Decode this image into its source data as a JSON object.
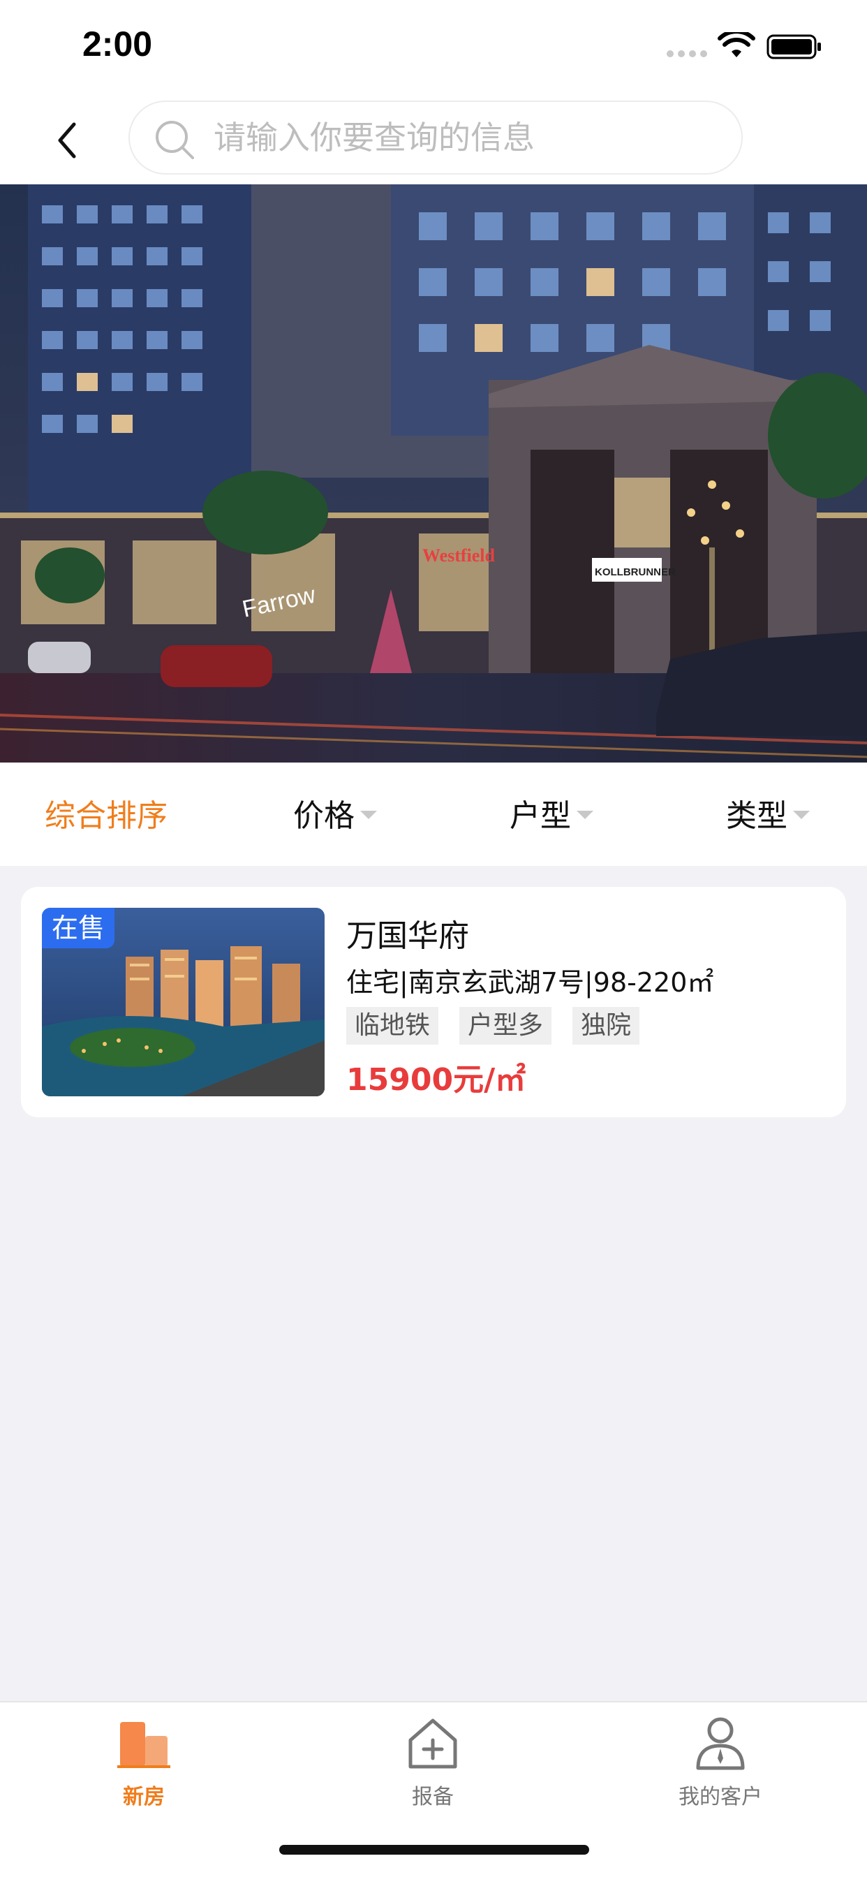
{
  "status_bar": {
    "time": "2:00"
  },
  "search": {
    "placeholder": "请输入你要查询的信息",
    "value": ""
  },
  "banner": {
    "signs": [
      "Farrow",
      "Westfield",
      "KOLLBRUNNER"
    ],
    "page_count": 2,
    "active_page": 2
  },
  "filters": [
    {
      "label": "综合排序",
      "active": true
    },
    {
      "label": "价格",
      "active": false
    },
    {
      "label": "户型",
      "active": false
    },
    {
      "label": "类型",
      "active": false
    }
  ],
  "listing": {
    "badge": "在售",
    "title": "万国华府",
    "info": "住宅|南京玄武湖7号|98-220㎡",
    "tags": [
      "临地铁",
      "户型多",
      "独院"
    ],
    "price": "15900元/㎡"
  },
  "tabs": [
    {
      "label": "新房",
      "icon": "building-icon",
      "active": true
    },
    {
      "label": "报备",
      "icon": "house-plus-icon",
      "active": false
    },
    {
      "label": "我的客户",
      "icon": "customer-icon",
      "active": false
    }
  ],
  "colors": {
    "accent": "#f07d1c",
    "price": "#e83c3c",
    "badge": "#2c6df0",
    "background": "#f1f1f6"
  }
}
